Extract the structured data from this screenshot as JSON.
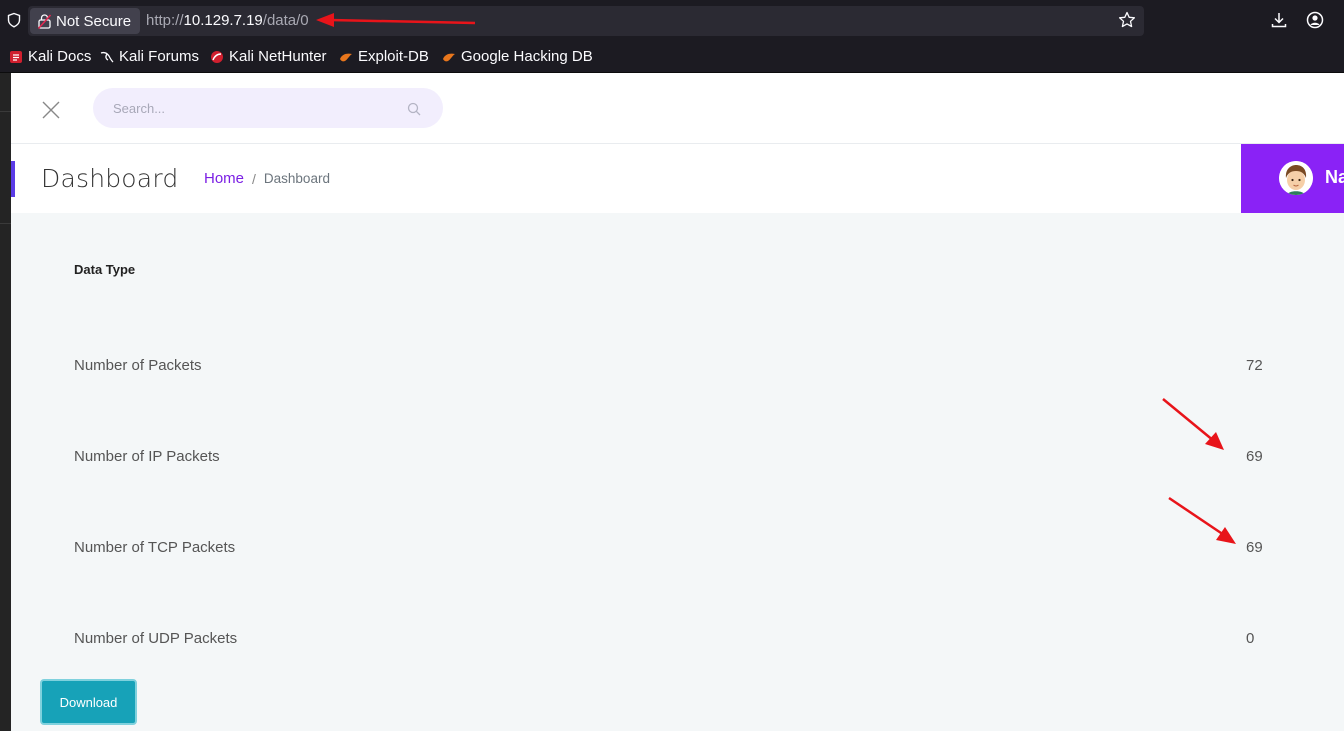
{
  "browser": {
    "security_label": "Not Secure",
    "url_scheme": "http://",
    "url_host": "10.129.7.19",
    "url_path": "/data/0",
    "bookmarks": [
      {
        "label": "Kali Docs",
        "icon": "kali-docs-icon"
      },
      {
        "label": "Kali Forums",
        "icon": "kali-dragon-icon"
      },
      {
        "label": "Kali NetHunter",
        "icon": "nethunter-icon"
      },
      {
        "label": "Exploit-DB",
        "icon": "exploit-db-icon"
      },
      {
        "label": "Google Hacking DB",
        "icon": "ghdb-icon"
      }
    ]
  },
  "topbar": {
    "search_placeholder": "Search..."
  },
  "header": {
    "title": "Dashboard",
    "breadcrumb_home": "Home",
    "breadcrumb_separator": "/",
    "breadcrumb_current": "Dashboard",
    "user_name": "Nathan"
  },
  "table": {
    "header": "Data Type",
    "rows": [
      {
        "label": "Number of Packets",
        "value": "72"
      },
      {
        "label": "Number of IP Packets",
        "value": "69"
      },
      {
        "label": "Number of TCP Packets",
        "value": "69"
      },
      {
        "label": "Number of UDP Packets",
        "value": "0"
      }
    ]
  },
  "actions": {
    "download_label": "Download"
  },
  "colors": {
    "accent": "#8a22f6",
    "breadcrumb_link": "#7b1fe4",
    "download_button": "#17a2b8",
    "annotation_arrow": "#e8141a"
  }
}
